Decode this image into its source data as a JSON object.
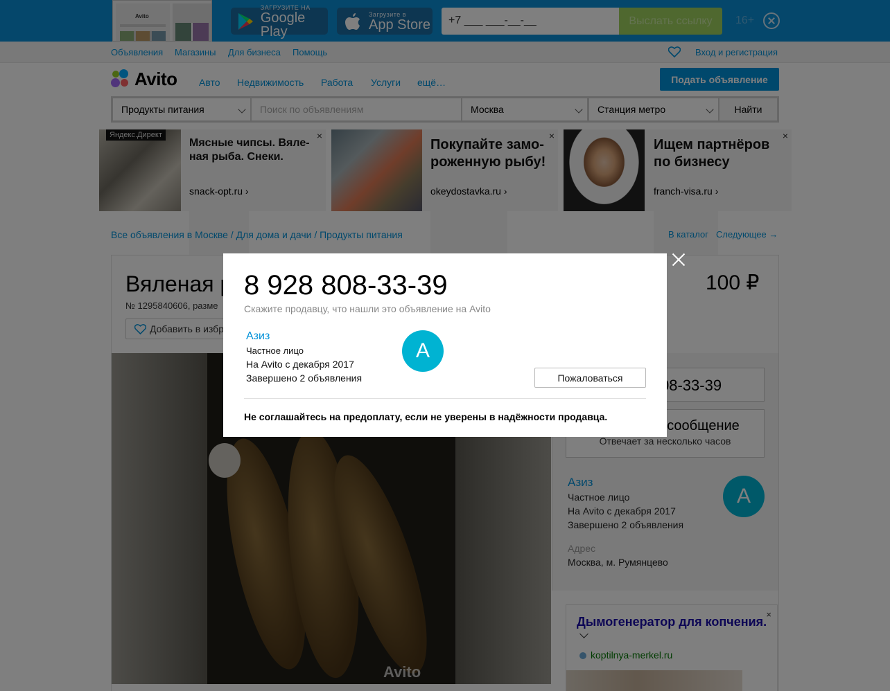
{
  "app_banner": {
    "google_play": {
      "small": "ЗАГРУЗИТЕ НА",
      "big": "Google Play"
    },
    "app_store": {
      "small": "Загрузите в",
      "big": "App Store"
    },
    "phone_input_value": "+7 ___ ___-__-__",
    "send_label": "Выслать ссылку",
    "age": "16+"
  },
  "topnav": {
    "items": [
      "Объявления",
      "Магазины",
      "Для бизнеса",
      "Помощь"
    ],
    "login": "Вход и регистрация"
  },
  "header": {
    "brand": "Avito",
    "categories": [
      "Авто",
      "Недвижимость",
      "Работа",
      "Услуги",
      "ещё…"
    ],
    "post_button": "Подать объявление"
  },
  "search": {
    "category": "Продукты питания",
    "placeholder": "Поиск по объявлениям",
    "city": "Москва",
    "metro": "Станция метро",
    "find": "Найти"
  },
  "ads": {
    "badge": "Яндекс.Директ",
    "items": [
      {
        "title": "Мясные чипсы. Вяле-ная рыба. Снеки.",
        "link": "snack-opt.ru ›"
      },
      {
        "title": "Покупайте замо-роженную рыбу!",
        "link": "okeydostavka.ru ›"
      },
      {
        "title": "Ищем партнёров по бизнесу",
        "link": "franch-visa.ru ›"
      }
    ],
    "close": "×"
  },
  "breadcrumbs": [
    "Все объявления в Москве",
    "Для дома и дачи",
    "Продукты питания"
  ],
  "crumb_sep": " / ",
  "right_links": {
    "catalog": "В каталог",
    "next": "Следующее →"
  },
  "item": {
    "title_partial": "Вяленая р",
    "number_partial": "№ 1295840606, разме",
    "favorite_partial": "Добавить в избр",
    "price": "100 ₽",
    "watermark": "Avito"
  },
  "sidebar": {
    "phone_partial": "08-33-39",
    "message_partial": "сообщение",
    "message_sub": "Отвечает за несколько часов",
    "seller": {
      "name": "Азиз",
      "type": "Частное лицо",
      "since": "На Avito с декабря 2017",
      "completed": "Завершено 2 объявления",
      "initial": "А"
    },
    "address_label": "Адрес",
    "address": "Москва, м. Румянцево"
  },
  "side_ad": {
    "title": "Дымогенератор для копчения.",
    "url": "koptilnya-merkel.ru",
    "close": "×"
  },
  "modal": {
    "phone": "8 928 808-33-39",
    "hint": "Скажите продавцу, что нашли это объявление на Avito",
    "seller": {
      "name": "Азиз",
      "type": "Частное лицо",
      "since": "На Avito с декабря 2017",
      "completed": "Завершено 2 объявления",
      "initial": "А"
    },
    "report": "Пожаловаться",
    "warning": "Не соглашайтесь на предоплату, если не уверены в надёжности продавца."
  },
  "colors": {
    "accent": "#0091d9",
    "banner": "#0a8fd6",
    "avatar": "#00b3d2",
    "send": "#9fd05e"
  }
}
